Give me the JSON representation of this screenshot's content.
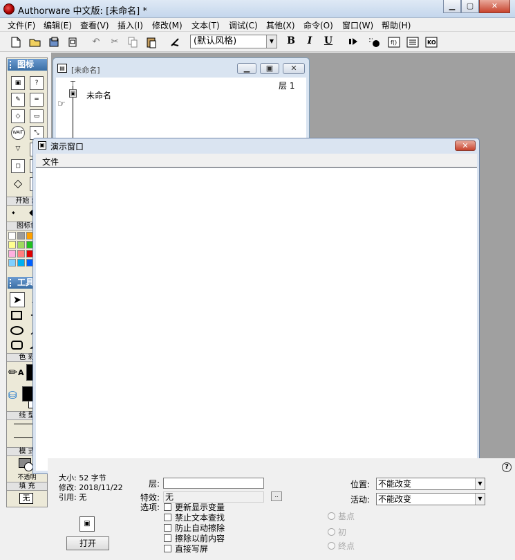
{
  "window": {
    "title": "Authorware 中文版: [未命名] *"
  },
  "menu": [
    "文件(F)",
    "编辑(E)",
    "查看(V)",
    "插入(I)",
    "修改(M)",
    "文本(T)",
    "调试(C)",
    "其他(X)",
    "命令(O)",
    "窗口(W)",
    "帮助(H)"
  ],
  "toolbar": {
    "style_select": "(默认风格)",
    "bold": "B",
    "italic": "I",
    "underline": "U"
  },
  "icon_palette": {
    "title": "图标",
    "start_label": "开始",
    "end_label": "结",
    "color_label": "图标色"
  },
  "tools_palette": {
    "title": "工具",
    "color_label": "色 彩",
    "line_label": "线 型",
    "mode_label": "模 式",
    "mode_value": "不透明",
    "fill_label": "填 充",
    "fill_value": "无"
  },
  "flowline": {
    "title": "[未命名]",
    "level_label": "层 1",
    "root_name": "未命名"
  },
  "presentation": {
    "title": "演示窗口",
    "menu_file": "文件"
  },
  "properties": {
    "size": "大小: 52 字节",
    "modified": "修改: 2018/11/22",
    "ref": "引用: 无",
    "open_button": "打开",
    "layer_label": "层:",
    "effect_label": "特效:",
    "effect_value": "无",
    "options_label": "选项:",
    "options": [
      "更新显示变量",
      "禁止文本查找",
      "防止自动擦除",
      "擦除以前内容",
      "直接写屏"
    ],
    "position_label": "位置:",
    "position_value": "不能改变",
    "activity_label": "活动:",
    "activity_value": "不能改变",
    "radio_options": [
      "基点",
      "初",
      "终点"
    ],
    "help": "?"
  }
}
